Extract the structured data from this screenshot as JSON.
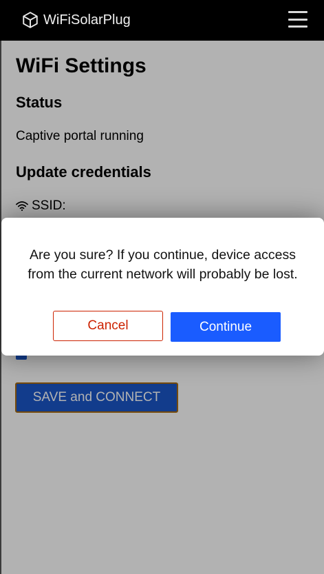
{
  "navbar": {
    "brand": "WiFiSolarPlug",
    "brand_icon": "cube-icon",
    "menu_icon": "hamburger-menu-icon"
  },
  "page": {
    "title": "WiFi Settings",
    "status_heading": "Status",
    "status_text": "Captive portal running",
    "update_heading": "Update credentials",
    "ssid_label": "SSID:",
    "ssid_icon": "wifi-icon",
    "remember_checked": true,
    "save_button": "SAVE and CONNECT"
  },
  "dialog": {
    "message_line1": "Are you sure? If you continue, device access",
    "message_line2": "from the current network will probably be lost.",
    "cancel_label": "Cancel",
    "continue_label": "Continue"
  },
  "colors": {
    "navbar_bg": "#000000",
    "accent_blue": "#1a5cff",
    "cancel_red": "#cc2200",
    "save_border": "#a86a10"
  }
}
